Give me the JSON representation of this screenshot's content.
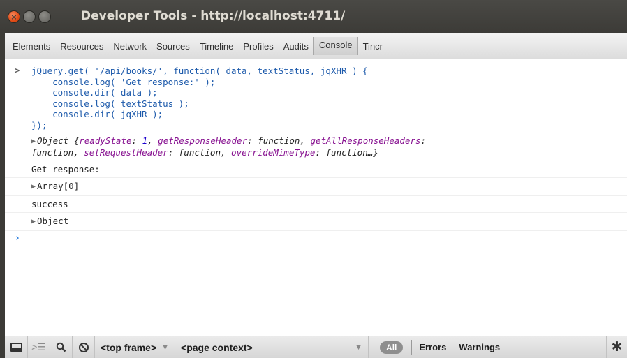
{
  "window": {
    "title": "Developer Tools - http://localhost:4711/",
    "close_glyph": "×",
    "minimize_glyph": "–",
    "maximize_glyph": "□"
  },
  "tabs": [
    {
      "label": "Elements"
    },
    {
      "label": "Resources"
    },
    {
      "label": "Network"
    },
    {
      "label": "Sources"
    },
    {
      "label": "Timeline"
    },
    {
      "label": "Profiles"
    },
    {
      "label": "Audits"
    },
    {
      "label": "Console",
      "active": true
    },
    {
      "label": "Tincr"
    }
  ],
  "console": {
    "command": "jQuery.get( '/api/books/', function( data, textStatus, jqXHR ) {\n    console.log( 'Get response:' );\n    console.dir( data );\n    console.log( textStatus );\n    console.dir( jqXHR );\n});",
    "result_object": {
      "prefix": "Object {",
      "k1": "readyState",
      "v1": "1",
      "k2": "getResponseHeader",
      "v2": "function",
      "k3": "getAllResponseHeaders",
      "v3": "function",
      "k4": "setRequestHeader",
      "v4": "function",
      "k5": "overrideMimeType",
      "v5": "function…}"
    },
    "log_get_response": "Get response:",
    "dir_array": "Array[0]",
    "log_status": "success",
    "dir_object": "Object"
  },
  "statusbar": {
    "frame_select": "<top frame>",
    "context_select": "<page context>",
    "filter_all": "All",
    "filter_errors": "Errors",
    "filter_warnings": "Warnings"
  },
  "icons": {
    "dock": "dock-icon",
    "show_console": "console-drawer-icon",
    "search": "search-icon",
    "clear": "clear-console-icon",
    "settings": "gear-icon"
  }
}
